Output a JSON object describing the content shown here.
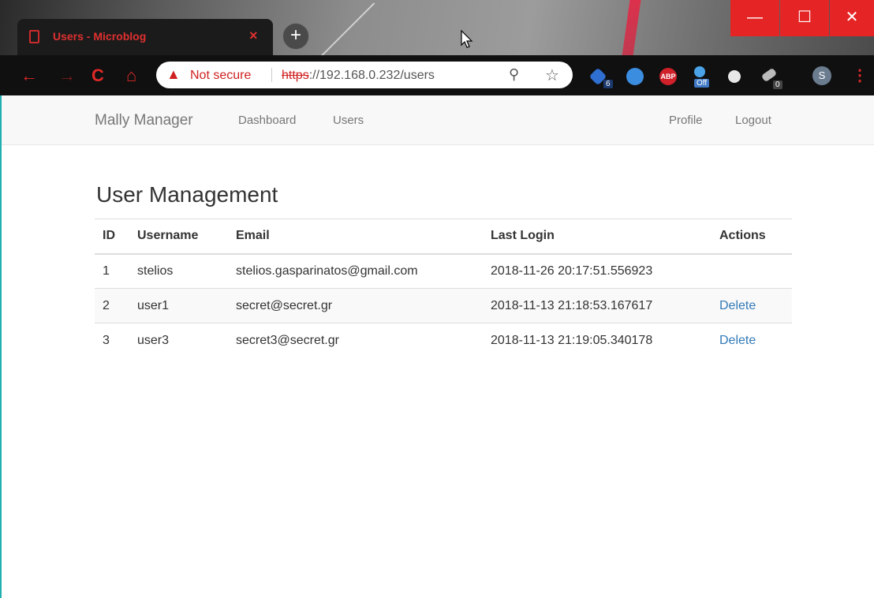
{
  "browser": {
    "tab_title": "Users - Microblog",
    "tab_close": "×",
    "new_tab": "+",
    "window_controls": {
      "minimize": "—",
      "maximize": "☐",
      "close": "✕"
    },
    "nav": {
      "back": "←",
      "forward": "→",
      "reload": "C",
      "home": "⌂"
    },
    "security_label": "Not secure",
    "url_protocol": "https",
    "url_rest": "://192.168.0.232/users",
    "extensions": [
      {
        "name": "extension-blue-icon",
        "badge": "6"
      },
      {
        "name": "extension-compass-icon",
        "badge": ""
      },
      {
        "name": "adblock-plus-icon",
        "badge": "ABP"
      },
      {
        "name": "extension-off-icon",
        "badge": "Off"
      },
      {
        "name": "extension-circle-icon",
        "badge": ""
      },
      {
        "name": "extension-satellite-icon",
        "badge": "0"
      }
    ],
    "profile_initial": "S"
  },
  "navbar": {
    "brand": "Mally Manager",
    "links": [
      "Dashboard",
      "Users"
    ],
    "right_links": [
      "Profile",
      "Logout"
    ]
  },
  "main": {
    "heading": "User Management",
    "table": {
      "headers": [
        "ID",
        "Username",
        "Email",
        "Last Login",
        "Actions"
      ],
      "rows": [
        {
          "id": "1",
          "username": "stelios",
          "email": "stelios.gasparinatos@gmail.com",
          "last_login": "2018-11-26 20:17:51.556923",
          "action": ""
        },
        {
          "id": "2",
          "username": "user1",
          "email": "secret@secret.gr",
          "last_login": "2018-11-13 21:18:53.167617",
          "action": "Delete"
        },
        {
          "id": "3",
          "username": "user3",
          "email": "secret3@secret.gr",
          "last_login": "2018-11-13 21:19:05.340178",
          "action": "Delete"
        }
      ]
    }
  },
  "colors": {
    "accent_red": "#e02828",
    "link_blue": "#337ab7"
  }
}
